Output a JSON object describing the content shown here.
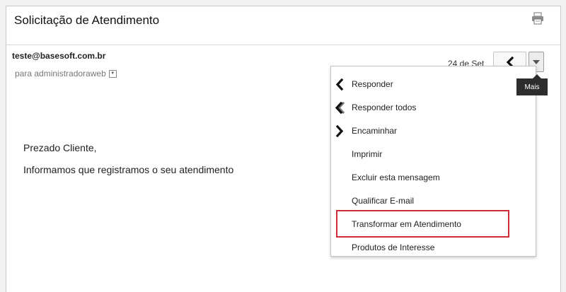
{
  "email": {
    "subject": "Solicitação de Atendimento",
    "sender": "teste@basesoft.com.br",
    "recipient": "para administradoraweb",
    "date": "24 de Set",
    "body": [
      "Prezado Cliente,",
      "Informamos que registramos o seu atendimento"
    ]
  },
  "toolbar": {
    "print_icon": "printer-icon",
    "reply_icon": "reply-arrow-icon",
    "more_icon": "caret-down-icon",
    "more_tooltip": "Mais"
  },
  "menu": {
    "items": [
      {
        "label": "Responder",
        "icon": "reply-icon"
      },
      {
        "label": "Responder todos",
        "icon": "reply-all-icon"
      },
      {
        "label": "Encaminhar",
        "icon": "forward-icon"
      },
      {
        "label": "Imprimir",
        "icon": ""
      },
      {
        "label": "Excluir esta mensagem",
        "icon": ""
      },
      {
        "label": "Qualificar E-mail",
        "icon": ""
      },
      {
        "label": "Transformar em Atendimento",
        "icon": "",
        "highlighted": true
      },
      {
        "label": "Produtos de Interesse",
        "icon": ""
      }
    ]
  },
  "colors": {
    "highlight_border": "#cc2b37",
    "tooltip_bg": "#2d2d2d"
  }
}
